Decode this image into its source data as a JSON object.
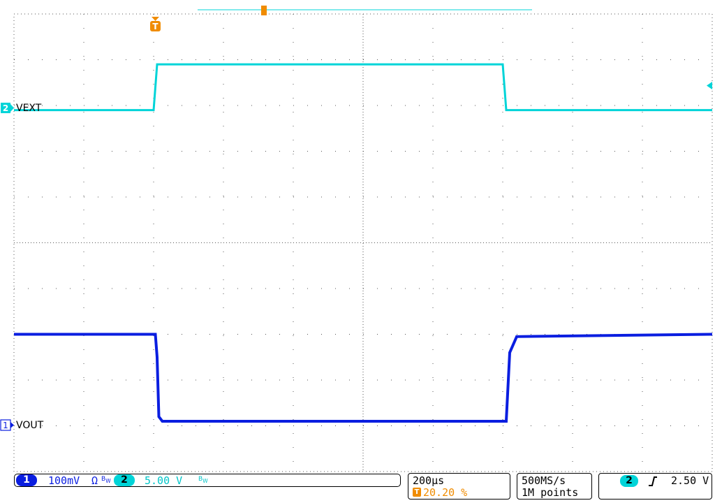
{
  "chart_data": {
    "type": "line",
    "title": "",
    "x": {
      "unit": "µs",
      "div": 200,
      "divisions": 10,
      "range": [
        -1000,
        1000
      ]
    },
    "grid": true,
    "series": [
      {
        "name": "VEXT",
        "channel": "2",
        "color": "#00d4d8",
        "volts_per_div": 5.0,
        "offset_div": -2.9,
        "points_us": [
          [
            -1000,
            0
          ],
          [
            -600,
            0
          ],
          [
            -590,
            5.0
          ],
          [
            400,
            5.0
          ],
          [
            410,
            0
          ],
          [
            1000,
            0
          ]
        ]
      },
      {
        "name": "VOUT",
        "channel": "1",
        "color": "#0a1ee0",
        "volts_per_div": 0.1,
        "offset_div": 4.0,
        "points_us": [
          [
            -1000,
            0.2
          ],
          [
            -595,
            0.2
          ],
          [
            -590,
            0.15
          ],
          [
            -585,
            0.02
          ],
          [
            -575,
            0.01
          ],
          [
            400,
            0.01
          ],
          [
            410,
            0.01
          ],
          [
            420,
            0.16
          ],
          [
            440,
            0.195
          ],
          [
            1000,
            0.2
          ]
        ]
      }
    ]
  },
  "labels": {
    "vext": "VEXT",
    "vout": "VOUT"
  },
  "markers": {
    "ch2_badge": "2",
    "ch1_badge": "1",
    "trigger_symbol": "T"
  },
  "status": {
    "ch1_num": "1",
    "ch1_scale": "100mV",
    "ch1_coupling": "Ω",
    "ch2_num": "2",
    "ch2_scale": "5.00 V",
    "timebase": "200µs",
    "trigger_pos": "20.20 %",
    "sample_rate": "500MS/s",
    "record_len": "1M points",
    "trig_src": "2",
    "trig_level": "2.50 V"
  },
  "colors": {
    "ch1": "#0a1ee0",
    "ch2": "#00d4d8",
    "trigger": "#f08c00",
    "grid": "#555555"
  }
}
